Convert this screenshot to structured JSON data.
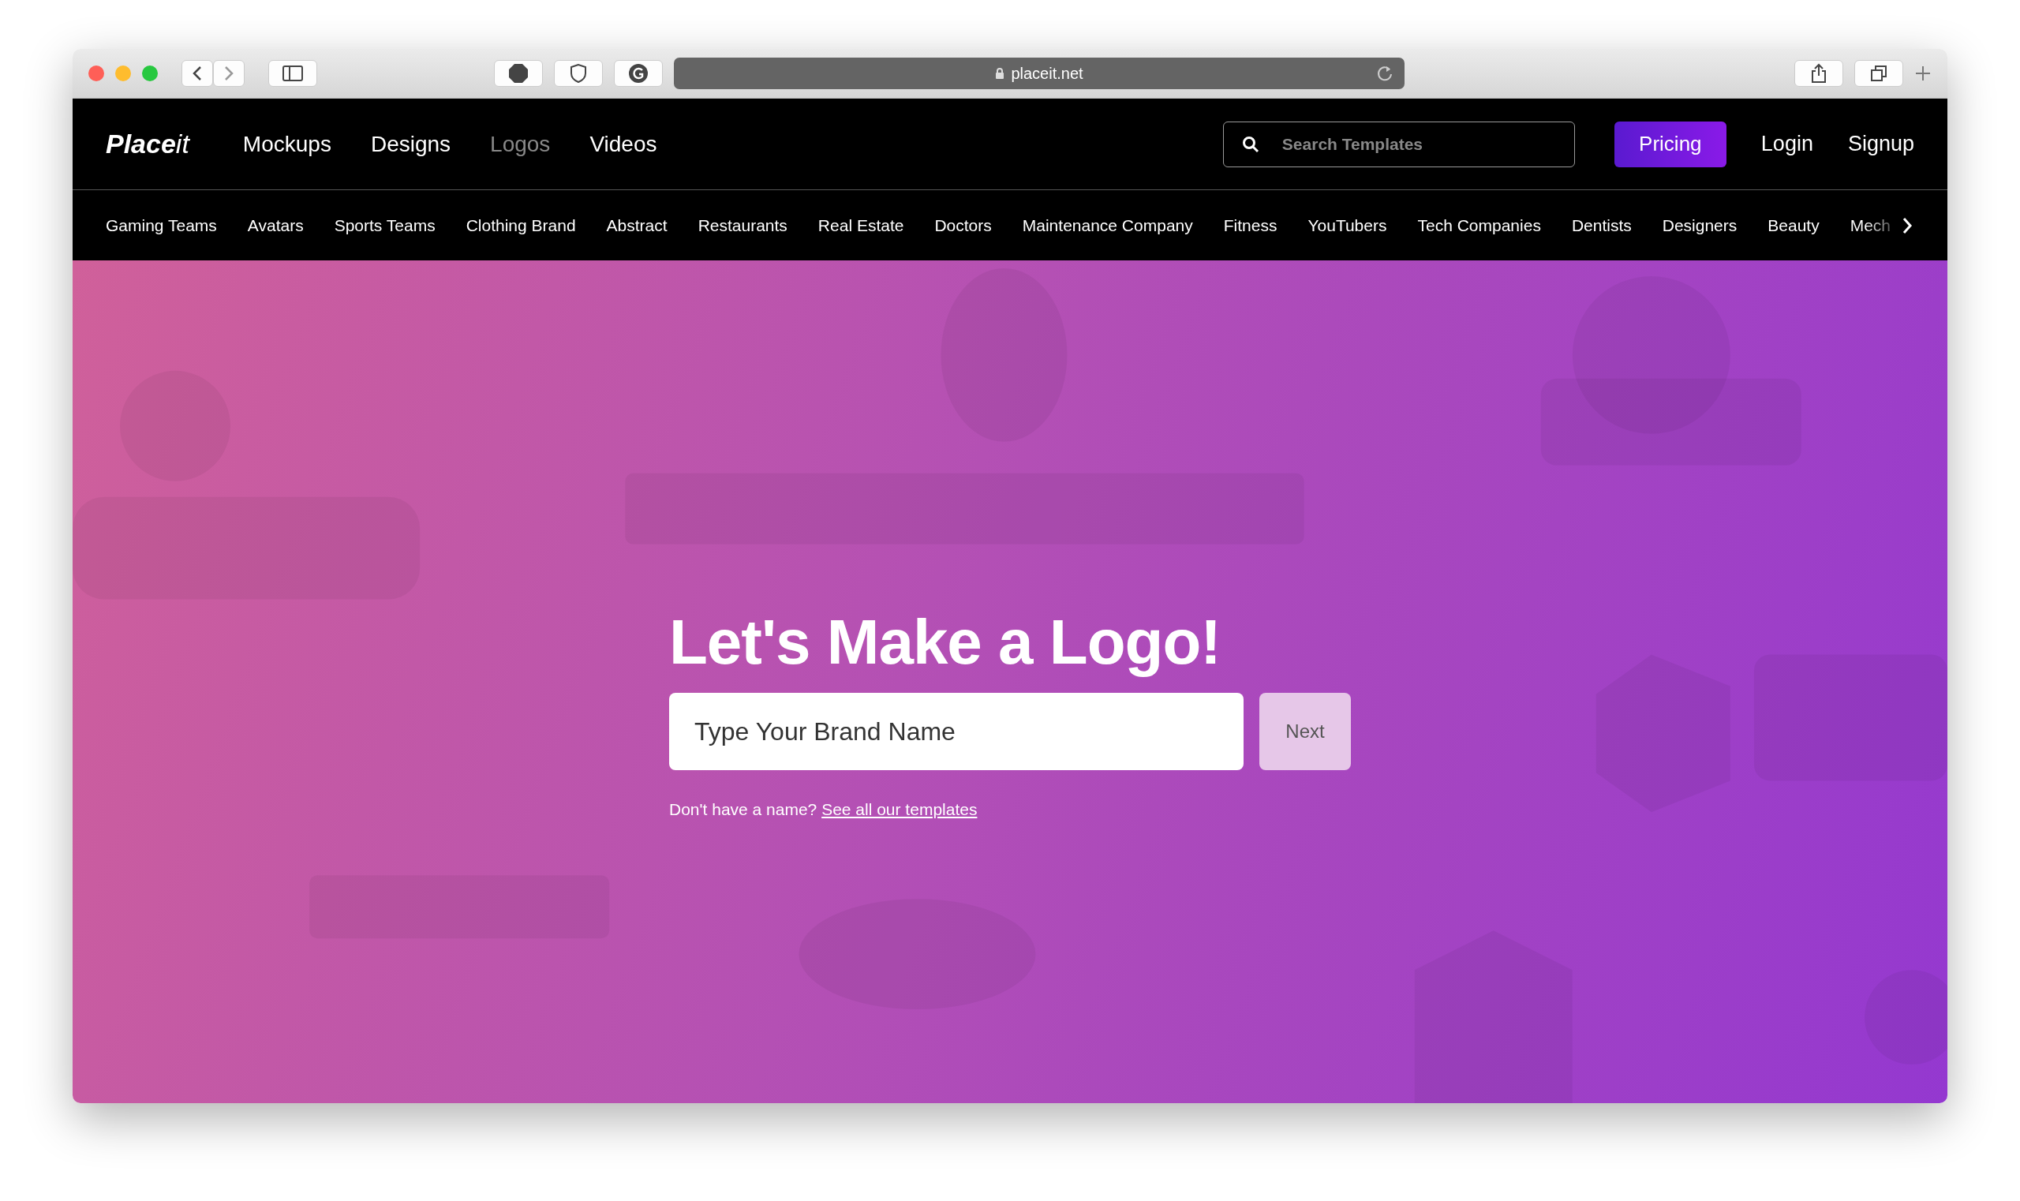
{
  "browser": {
    "address": "placeit.net"
  },
  "navbar": {
    "logo_bold": "Place",
    "logo_italic": "it",
    "items": [
      {
        "label": "Mockups",
        "selected": false
      },
      {
        "label": "Designs",
        "selected": false
      },
      {
        "label": "Logos",
        "selected": true
      },
      {
        "label": "Videos",
        "selected": false
      }
    ],
    "search": {
      "placeholder": "Search Templates"
    },
    "pricing": "Pricing",
    "login": "Login",
    "signup": "Signup"
  },
  "categories": [
    "Gaming Teams",
    "Avatars",
    "Sports Teams",
    "Clothing Brand",
    "Abstract",
    "Restaurants",
    "Real Estate",
    "Doctors",
    "Maintenance Company",
    "Fitness",
    "YouTubers",
    "Tech Companies",
    "Dentists",
    "Designers",
    "Beauty",
    "Mech"
  ],
  "hero": {
    "title": "Let's Make a Logo!",
    "input": {
      "placeholder": "Type Your Brand Name"
    },
    "next": {
      "label": "Next",
      "disabled": true
    },
    "hint": "Don't have a name?",
    "link": "See all our templates"
  }
}
